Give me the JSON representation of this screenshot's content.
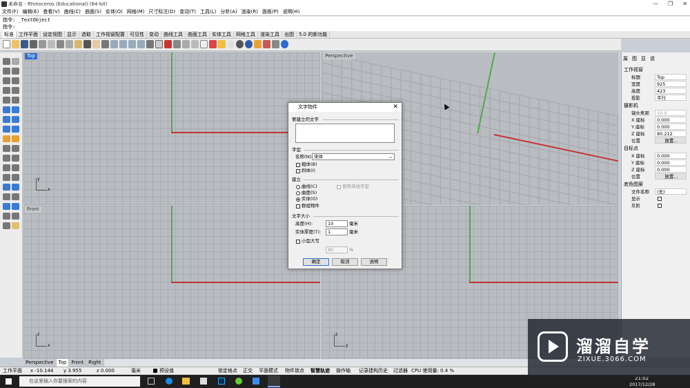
{
  "window": {
    "title": "未命名 - Rhinoceros (Educational) (64-bit)",
    "btns": [
      "—",
      "❐",
      "✕"
    ]
  },
  "menu": [
    "文件(F)",
    "编辑(E)",
    "查看(V)",
    "曲线(C)",
    "曲面(S)",
    "实体(O)",
    "网格(M)",
    "尺寸标注(D)",
    "变动(T)",
    "工具(L)",
    "分析(A)",
    "渲染(R)",
    "面板(P)",
    "说明(H)"
  ],
  "cmd": {
    "line1": "指令: _TextObject",
    "line2": "指令:"
  },
  "tabs": [
    "标准",
    "工作平面",
    "设定视图",
    "显示",
    "选取",
    "工作视窗配置",
    "可见性",
    "变动",
    "曲线工具",
    "曲面工具",
    "实体工具",
    "网格工具",
    "渲染工具",
    "出图",
    "5.0 的新功能"
  ],
  "viewports": {
    "top": "Top",
    "persp": "Perspective",
    "front": "Front",
    "right": "Right"
  },
  "axis": {
    "x": "x",
    "y": "y",
    "z": "z"
  },
  "panel": {
    "tabs": [
      "属",
      "图",
      "显",
      "说"
    ],
    "sec1": "工作视窗",
    "rows1": [
      [
        "标题",
        "Top"
      ],
      [
        "宽度",
        "925"
      ],
      [
        "高度",
        "423"
      ],
      [
        "投影",
        "平行"
      ]
    ],
    "sec2": "摄影机",
    "rows2": [
      [
        "镜头焦距",
        "50.0"
      ],
      [
        "X 座标",
        "0.000"
      ],
      [
        "Y 座标",
        "0.000"
      ],
      [
        "Z 座标",
        "80.212"
      ],
      [
        "位置",
        "放置..."
      ]
    ],
    "sec3": "目标点",
    "rows3": [
      [
        "X 座标",
        "0.000"
      ],
      [
        "Y 座标",
        "0.000"
      ],
      [
        "Z 座标",
        "0.000"
      ],
      [
        "位置",
        "放置..."
      ]
    ],
    "sec4": "底色图案",
    "rows4": [
      [
        "文件名称",
        "(无)"
      ],
      [
        "显示",
        ""
      ],
      [
        "灰阶",
        ""
      ]
    ]
  },
  "bottomtabs": [
    "Perspective",
    "Top",
    "Front",
    "Right"
  ],
  "status": {
    "plane": "工作平面",
    "x": "x -10.144",
    "y": "y 3.955",
    "z": "z 0.000",
    "unit": "毫米",
    "layer": "预设值",
    "snaps": [
      "锁定格点",
      "正交",
      "平面模式",
      "物件锁点",
      "智慧轨迹",
      "操作轴",
      "记录建构历史",
      "过滤器"
    ],
    "cpu": "CPU 使用量: 0.4 %"
  },
  "taskbar": {
    "search": "在这里输入你要搜索的内容",
    "time": "21:02",
    "date": "2017/12/28"
  },
  "dialog": {
    "title": "文字物件",
    "text_label": "要建立的文字",
    "font_section": "字型",
    "font_name_label": "名称(N):",
    "font_value": "宋体",
    "bold": "粗体(B)",
    "italic": "斜体(I)",
    "create_section": "建立",
    "opt_curve": "曲线(C)",
    "opt_surface": "曲面(S)",
    "opt_solid": "实体(O)",
    "single_stroke": "使用单线字型",
    "group": "群组物件",
    "size_section": "文字大小",
    "height_label": "高度(H):",
    "height_value": "10",
    "height_unit": "毫米",
    "thick_label": "实体厚度(T):",
    "thick_value": "1",
    "thick_unit": "毫米",
    "smallcaps": "小型大写",
    "pct_value": "80",
    "pct": "%",
    "ok": "确定",
    "cancel": "取消",
    "help": "说明"
  },
  "watermark": {
    "brand": "溜溜自学",
    "url": "ZIXUE.3066.COM"
  }
}
